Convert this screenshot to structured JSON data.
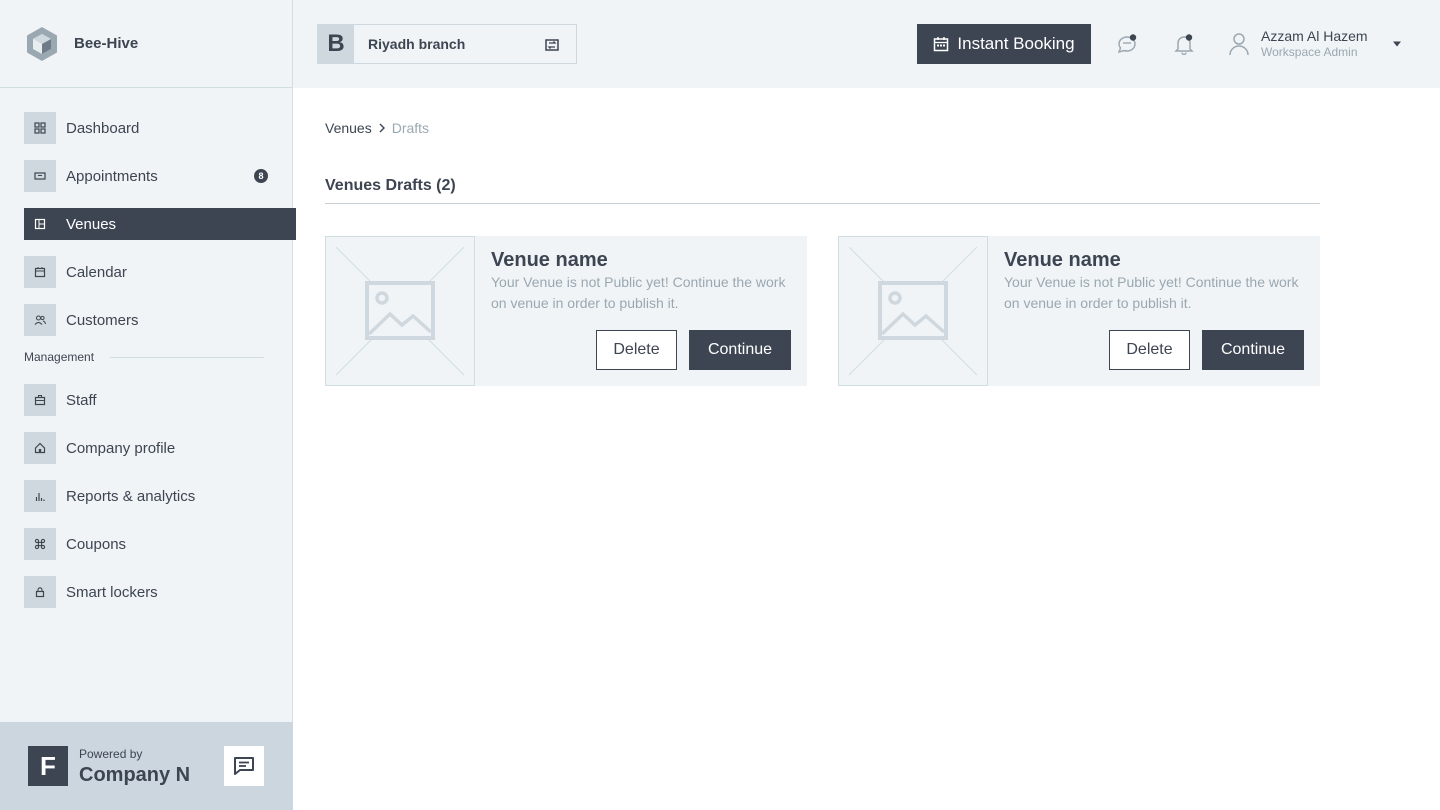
{
  "brand": {
    "name": "Bee-Hive"
  },
  "sidebar": {
    "items": [
      {
        "label": "Dashboard",
        "icon": "grid-icon"
      },
      {
        "label": "Appointments",
        "icon": "ticket-icon",
        "badge": "8"
      },
      {
        "label": "Venues",
        "icon": "building-icon",
        "active": true
      },
      {
        "label": "Calendar",
        "icon": "calendar-icon"
      },
      {
        "label": "Customers",
        "icon": "users-icon"
      }
    ],
    "section_label": "Management",
    "management_items": [
      {
        "label": "Staff",
        "icon": "briefcase-icon"
      },
      {
        "label": "Company profile",
        "icon": "home-icon"
      },
      {
        "label": "Reports & analytics",
        "icon": "bar-chart-icon"
      },
      {
        "label": "Coupons",
        "icon": "command-icon"
      },
      {
        "label": "Smart lockers",
        "icon": "lock-icon"
      }
    ]
  },
  "footer": {
    "logo_letter": "F",
    "powered_by": "Powered by",
    "company": "Company N"
  },
  "header": {
    "branch_letter": "B",
    "branch_name": "Riyadh branch",
    "instant_booking": "Instant Booking",
    "user_name": "Azzam Al Hazem",
    "user_role": "Workspace Admin"
  },
  "breadcrumb": {
    "parent": "Venues",
    "current": "Drafts"
  },
  "main": {
    "heading": "Venues Drafts (2)",
    "cards": [
      {
        "title": "Venue name",
        "description": "Your Venue is not Public yet! Continue the work on venue in order to publish it.",
        "delete_label": "Delete",
        "continue_label": "Continue"
      },
      {
        "title": "Venue name",
        "description": "Your Venue is not Public yet! Continue the work on venue in order to publish it.",
        "delete_label": "Delete",
        "continue_label": "Continue"
      }
    ]
  },
  "colors": {
    "primary": "#3d4552",
    "muted": "#9aa8b2",
    "surface": "#f1f4f6",
    "icon_bg": "#cfd8de"
  }
}
